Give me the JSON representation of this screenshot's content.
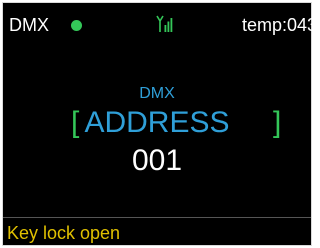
{
  "status_bar": {
    "mode": "DMX",
    "status_indicator": "green-dot",
    "signal_icon": "signal-bars-icon",
    "temperature": "temp:043"
  },
  "main": {
    "sub_title": "DMX",
    "bracket_left": "[",
    "parameter": "ADDRESS",
    "bracket_right": "]",
    "value": "001"
  },
  "footer": {
    "message": "Key lock open"
  },
  "colors": {
    "background": "#000000",
    "accent_blue": "#2f9fd8",
    "accent_green": "#34c759",
    "footer_yellow": "#e0c000",
    "text_white": "#ffffff"
  }
}
